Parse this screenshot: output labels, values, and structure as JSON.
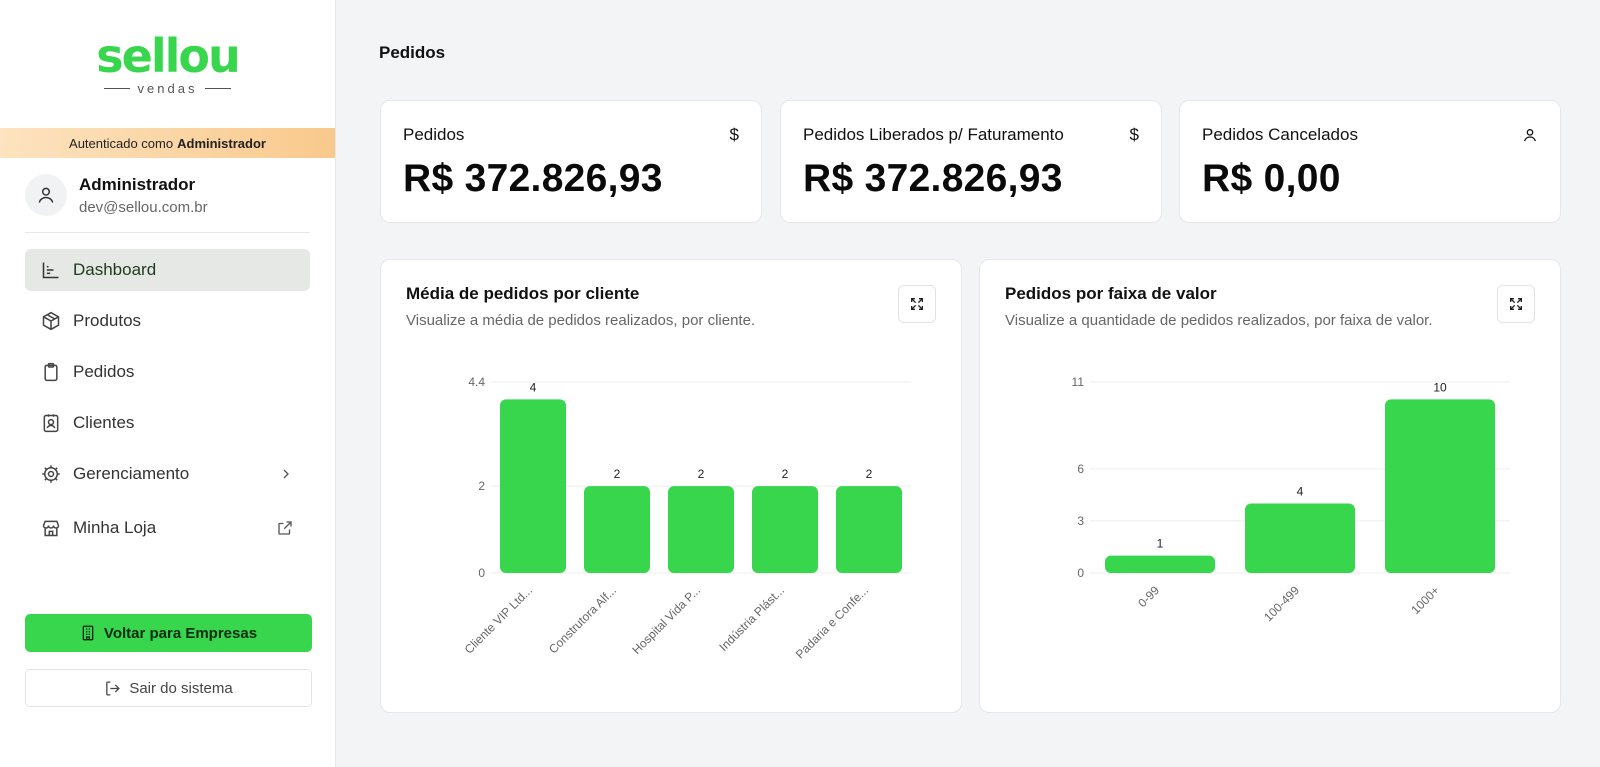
{
  "sidebar": {
    "logo": {
      "word": "sellou",
      "sub": "vendas"
    },
    "auth": {
      "prefix": "Autenticado como",
      "role": "Administrador"
    },
    "profile": {
      "name": "Administrador",
      "email": "dev@sellou.com.br"
    },
    "nav": [
      {
        "label": "Dashboard",
        "icon": "chart-icon",
        "active": true
      },
      {
        "label": "Produtos",
        "icon": "box-icon"
      },
      {
        "label": "Pedidos",
        "icon": "clipboard-icon"
      },
      {
        "label": "Clientes",
        "icon": "contact-icon"
      },
      {
        "label": "Gerenciamento",
        "icon": "gear-icon",
        "trail": "chevron-right-icon"
      },
      {
        "label": "Minha Loja",
        "icon": "store-icon",
        "trail": "external-link-icon"
      }
    ],
    "back_button": "Voltar para Empresas",
    "logout_button": "Sair do sistema"
  },
  "main": {
    "page_title": "Pedidos",
    "stats": [
      {
        "label": "Pedidos",
        "value": "R$ 372.826,93",
        "icon": "dollar-icon"
      },
      {
        "label": "Pedidos Liberados p/ Faturamento",
        "value": "R$ 372.826,93",
        "icon": "dollar-icon"
      },
      {
        "label": "Pedidos Cancelados",
        "value": "R$ 0,00",
        "icon": "user-icon"
      }
    ],
    "charts": [
      {
        "title": "Média de pedidos por cliente",
        "subtitle": "Visualize a média de pedidos realizados, por cliente."
      },
      {
        "title": "Pedidos por faixa de valor",
        "subtitle": "Visualize a quantidade de pedidos realizados, por faixa de valor."
      }
    ]
  },
  "colors": {
    "accent": "#37d64d",
    "auth_bar": "#f9c98c"
  },
  "chart_data": [
    {
      "type": "bar",
      "categories": [
        "Cliente VIP Ltd...",
        "Construtora Alf...",
        "Hospital Vida P...",
        "Indústria Plást...",
        "Padaria e Confe..."
      ],
      "values": [
        4,
        2,
        2,
        2,
        2
      ],
      "yticks": [
        "0",
        "2",
        "4.4"
      ],
      "ylim": [
        0,
        4.4
      ],
      "grid": true
    },
    {
      "type": "bar",
      "categories": [
        "0-99",
        "100-499",
        "1000+"
      ],
      "values": [
        1,
        4,
        10
      ],
      "yticks": [
        "0",
        "3",
        "6",
        "11"
      ],
      "ylim": [
        0,
        11
      ],
      "grid": true
    }
  ]
}
